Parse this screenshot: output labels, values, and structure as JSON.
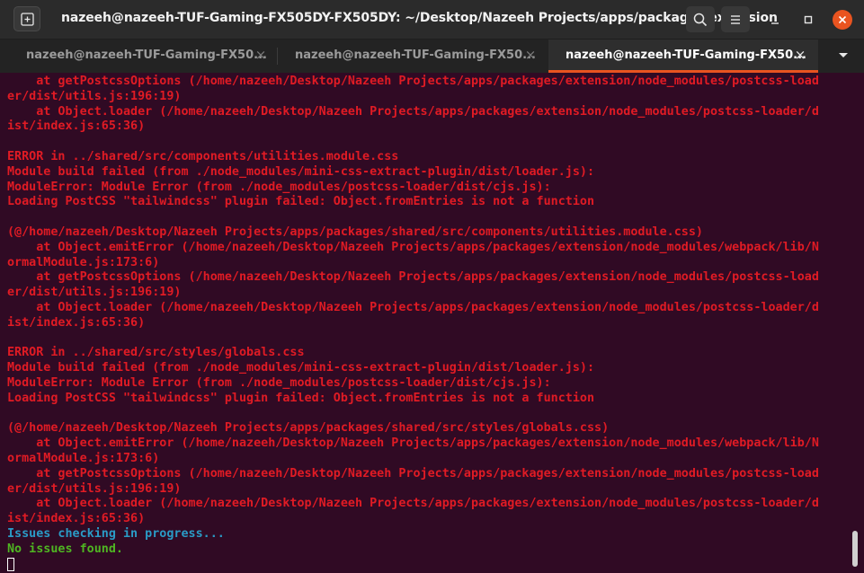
{
  "window": {
    "title": "nazeeh@nazeeh-TUF-Gaming-FX505DY-FX505DY: ~/Desktop/Nazeeh Projects/apps/packages/extension",
    "new_tab_icon": "new-tab-icon",
    "search_icon": "search-icon",
    "menu_icon": "hamburger-menu-icon",
    "minimize_icon": "minimize-icon",
    "maximize_icon": "maximize-icon",
    "close_icon": "close-icon",
    "close_color": "#e95420"
  },
  "tabs": [
    {
      "label": "nazeeh@nazeeh-TUF-Gaming-FX50...",
      "close": "×",
      "active": false
    },
    {
      "label": "nazeeh@nazeeh-TUF-Gaming-FX50...",
      "close": "×",
      "active": false
    },
    {
      "label": "nazeeh@nazeeh-TUF-Gaming-FX50...",
      "close": "×",
      "active": true
    }
  ],
  "tab_menu_icon": "chevron-down-icon",
  "colors": {
    "background": "#300a24",
    "error_text": "#e01b24",
    "info_text": "#2a9bc6",
    "success_text": "#4fb522",
    "accent": "#e95420"
  },
  "terminal": {
    "lines": [
      {
        "text": "    at getPostcssOptions (/home/nazeeh/Desktop/Nazeeh Projects/apps/packages/extension/node_modules/postcss-load",
        "color": "red"
      },
      {
        "text": "er/dist/utils.js:196:19)",
        "color": "red"
      },
      {
        "text": "    at Object.loader (/home/nazeeh/Desktop/Nazeeh Projects/apps/packages/extension/node_modules/postcss-loader/d",
        "color": "red"
      },
      {
        "text": "ist/index.js:65:36)",
        "color": "red"
      },
      {
        "text": "",
        "color": "red"
      },
      {
        "text": "ERROR in ../shared/src/components/utilities.module.css",
        "color": "red"
      },
      {
        "text": "Module build failed (from ./node_modules/mini-css-extract-plugin/dist/loader.js):",
        "color": "red"
      },
      {
        "text": "ModuleError: Module Error (from ./node_modules/postcss-loader/dist/cjs.js):",
        "color": "red"
      },
      {
        "text": "Loading PostCSS \"tailwindcss\" plugin failed: Object.fromEntries is not a function",
        "color": "red"
      },
      {
        "text": "",
        "color": "red"
      },
      {
        "text": "(@/home/nazeeh/Desktop/Nazeeh Projects/apps/packages/shared/src/components/utilities.module.css)",
        "color": "red"
      },
      {
        "text": "    at Object.emitError (/home/nazeeh/Desktop/Nazeeh Projects/apps/packages/extension/node_modules/webpack/lib/N",
        "color": "red"
      },
      {
        "text": "ormalModule.js:173:6)",
        "color": "red"
      },
      {
        "text": "    at getPostcssOptions (/home/nazeeh/Desktop/Nazeeh Projects/apps/packages/extension/node_modules/postcss-load",
        "color": "red"
      },
      {
        "text": "er/dist/utils.js:196:19)",
        "color": "red"
      },
      {
        "text": "    at Object.loader (/home/nazeeh/Desktop/Nazeeh Projects/apps/packages/extension/node_modules/postcss-loader/d",
        "color": "red"
      },
      {
        "text": "ist/index.js:65:36)",
        "color": "red"
      },
      {
        "text": "",
        "color": "red"
      },
      {
        "text": "ERROR in ../shared/src/styles/globals.css",
        "color": "red"
      },
      {
        "text": "Module build failed (from ./node_modules/mini-css-extract-plugin/dist/loader.js):",
        "color": "red"
      },
      {
        "text": "ModuleError: Module Error (from ./node_modules/postcss-loader/dist/cjs.js):",
        "color": "red"
      },
      {
        "text": "Loading PostCSS \"tailwindcss\" plugin failed: Object.fromEntries is not a function",
        "color": "red"
      },
      {
        "text": "",
        "color": "red"
      },
      {
        "text": "(@/home/nazeeh/Desktop/Nazeeh Projects/apps/packages/shared/src/styles/globals.css)",
        "color": "red"
      },
      {
        "text": "    at Object.emitError (/home/nazeeh/Desktop/Nazeeh Projects/apps/packages/extension/node_modules/webpack/lib/N",
        "color": "red"
      },
      {
        "text": "ormalModule.js:173:6)",
        "color": "red"
      },
      {
        "text": "    at getPostcssOptions (/home/nazeeh/Desktop/Nazeeh Projects/apps/packages/extension/node_modules/postcss-load",
        "color": "red"
      },
      {
        "text": "er/dist/utils.js:196:19)",
        "color": "red"
      },
      {
        "text": "    at Object.loader (/home/nazeeh/Desktop/Nazeeh Projects/apps/packages/extension/node_modules/postcss-loader/d",
        "color": "red"
      },
      {
        "text": "ist/index.js:65:36)",
        "color": "red"
      },
      {
        "text": "Issues checking in progress...",
        "color": "cyan"
      },
      {
        "text": "No issues found.",
        "color": "green"
      }
    ]
  }
}
